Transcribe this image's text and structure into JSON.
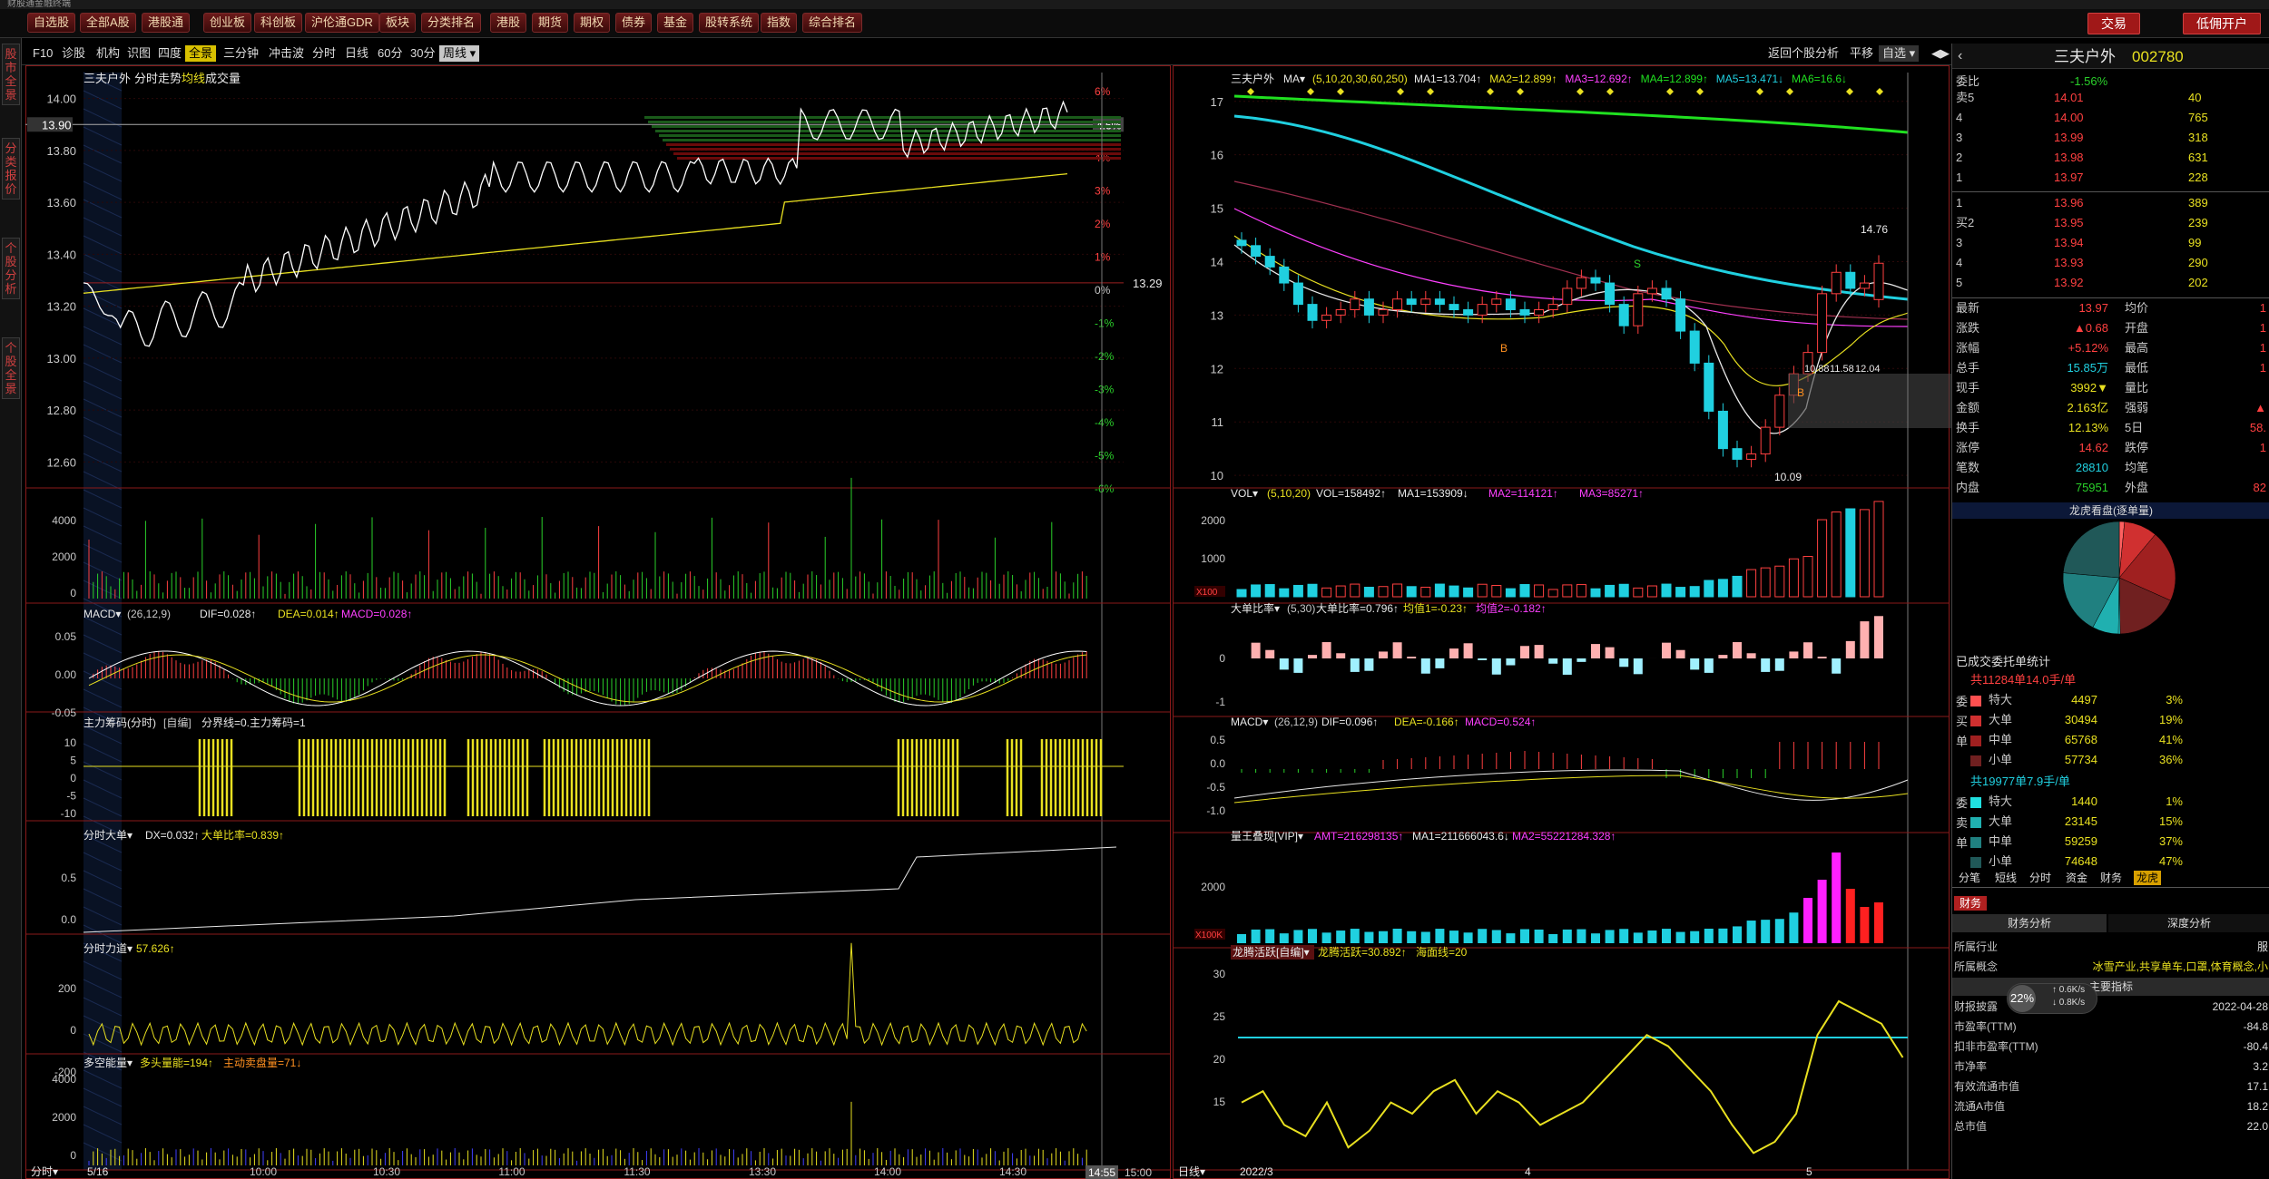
{
  "titlebar": {
    "left_text": "财股通金融终端"
  },
  "menubar": {
    "buttons": [
      "自选股",
      "全部A股",
      "港股通",
      "创业板",
      "科创板",
      "沪伦通GDR",
      "板块",
      "分类排名",
      "港股",
      "期货",
      "期权",
      "债券",
      "基金",
      "股转系统",
      "指数",
      "综合排名"
    ],
    "right_buttons": [
      "交易",
      "低佣开户"
    ]
  },
  "sidebar": {
    "tabs": [
      "股市全景",
      "分类报价",
      "个股分析",
      "个股全景"
    ]
  },
  "toolbar": {
    "items": [
      "F10",
      "诊股",
      "机构",
      "识图",
      "四度",
      "全景",
      "三分钟",
      "冲击波"
    ],
    "period": [
      "分时",
      "日线",
      "60分",
      "30分",
      "周线"
    ],
    "right": [
      "返回个股分析",
      "平移",
      "自选"
    ]
  },
  "intraday": {
    "title": "三夫户外",
    "sub": "分时走势",
    "legend": [
      "均线",
      "成交量"
    ],
    "price_labels": [
      "14.00",
      "13.80",
      "13.60",
      "13.40",
      "13.20",
      "13.00",
      "12.80",
      "12.60"
    ],
    "current_price_tag": "13.90",
    "pct_labels": [
      "6%",
      "5%",
      "4%",
      "3%",
      "2%",
      "1%",
      "0%",
      "-1%",
      "-2%",
      "-3%",
      "-4%",
      "-5%",
      "-6%"
    ],
    "current_pct_tag": "4.6%",
    "prev_close": "13.29",
    "vol_ticks": [
      "4000",
      "2000",
      "0"
    ],
    "date_label": "5/16",
    "time_axis": [
      "10:00",
      "10:30",
      "11:00",
      "11:30",
      "13:30",
      "14:00",
      "14:30",
      "15:00"
    ],
    "time_tag": "14:55",
    "axis_caption": "分时",
    "macd": {
      "name": "MACD",
      "params": "(26,12,9)",
      "dif": "DIF=0.028↑",
      "dea": "DEA=0.014↑",
      "macd": "MACD=0.028↑",
      "ticks": [
        "0.05",
        "0.00",
        "-0.05"
      ]
    },
    "zlcm": {
      "name": "主力筹码(分时)",
      "tag": "[自编]",
      "text": "分界线=0.主力筹码=1",
      "ticks": [
        "10",
        "5",
        "0",
        "-5",
        "-10"
      ]
    },
    "fsdd": {
      "name": "分时大单",
      "dx": "DX=0.032↑",
      "ratio": "大单比率=0.839↑",
      "ticks": [
        "0.5",
        "0.0"
      ]
    },
    "fsld": {
      "name": "分时力道",
      "val": "57.626↑",
      "ticks": [
        "200",
        "0",
        "-200"
      ]
    },
    "dknl": {
      "name": "多空能量",
      "bull": "多头量能=194↑",
      "bear": "主动卖盘量=71↓",
      "ticks": [
        "4000",
        "2000",
        "0"
      ]
    }
  },
  "daily": {
    "title": "三夫户外",
    "ma_header": "MA",
    "ma_params": "(5,10,20,30,60,250)",
    "ma_values": [
      "MA1=13.704↑",
      "MA2=12.899↑",
      "MA3=12.692↑",
      "MA4=12.899↑",
      "MA5=13.471↓",
      "MA6=16.6↓"
    ],
    "ma_colors": [
      "#e8e8e8",
      "#e8e020",
      "#ff40ff",
      "#20e020",
      "#20d0e0",
      "#20e020"
    ],
    "price_ticks": [
      "17",
      "16",
      "15",
      "14",
      "13",
      "12",
      "11",
      "10"
    ],
    "marks": {
      "high": "14.76",
      "low": "10.09",
      "mid": "10.88",
      "mid2": "11.58",
      "mid3": "12.04"
    },
    "date_axis": [
      "2022/3",
      "4",
      "5"
    ],
    "axis_caption": "日线",
    "vol": {
      "name": "VOL",
      "params": "(5,10,20)",
      "val": "VOL=158492↑",
      "ma1": "MA1=153909↓",
      "ma2": "MA2=114121↑",
      "ma3": "MA3=85271↑",
      "ticks": [
        "2000",
        "1000"
      ],
      "unit_tag": "X100"
    },
    "ddbl": {
      "name": "大单比率",
      "params": "(5,30)",
      "val": "大单比率=0.796↑",
      "j1": "均值1=-0.23↑",
      "j2": "均值2=-0.182↑",
      "ticks": [
        "0",
        "-1"
      ]
    },
    "macd": {
      "name": "MACD",
      "params": "(26,12,9)",
      "dif": "DIF=0.096↑",
      "dea": "DEA=-0.166↑",
      "macd": "MACD=0.524↑",
      "ticks": [
        "0.5",
        "0.0",
        "-0.5",
        "-1.0"
      ]
    },
    "lw": {
      "name": "量王叠现[VIP]",
      "amt": "AMT=216298135↑",
      "ma1": "MA1=211666043.6↓",
      "ma2": "MA2=55221284.328↑",
      "ticks": [
        "2000"
      ],
      "unit_tag": "X100K"
    },
    "lthy": {
      "name": "龙腾活跃[自编]",
      "val": "龙腾活跃=30.892↑",
      "sea": "海面线=20",
      "ticks": [
        "30",
        "25",
        "20",
        "15"
      ]
    }
  },
  "quote": {
    "name": "三夫户外",
    "code": "002780",
    "weibi_label": "委比",
    "weibi_val": "-1.56%",
    "asks": [
      {
        "l": "卖5",
        "p": "14.01",
        "v": "40"
      },
      {
        "l": "4",
        "p": "14.00",
        "v": "765"
      },
      {
        "l": "3",
        "p": "13.99",
        "v": "318"
      },
      {
        "l": "2",
        "p": "13.98",
        "v": "631"
      },
      {
        "l": "1",
        "p": "13.97",
        "v": "228"
      }
    ],
    "bids": [
      {
        "l": "1",
        "p": "13.96",
        "v": "389"
      },
      {
        "l": "买2",
        "p": "13.95",
        "v": "239"
      },
      {
        "l": "3",
        "p": "13.94",
        "v": "99"
      },
      {
        "l": "4",
        "p": "13.93",
        "v": "290"
      },
      {
        "l": "5",
        "p": "13.92",
        "v": "202"
      }
    ],
    "stats_left": [
      {
        "k": "最新",
        "v": "13.97"
      },
      {
        "k": "涨跌",
        "v": "▲0.68"
      },
      {
        "k": "涨幅",
        "v": "+5.12%"
      },
      {
        "k": "总手",
        "v": "15.85万"
      },
      {
        "k": "现手",
        "v": "3992▼"
      },
      {
        "k": "金额",
        "v": "2.163亿"
      },
      {
        "k": "换手",
        "v": "12.13%"
      },
      {
        "k": "涨停",
        "v": "14.62"
      },
      {
        "k": "笔数",
        "v": "28810"
      },
      {
        "k": "内盘",
        "v": "75951"
      }
    ],
    "stats_right": [
      {
        "k": "均价",
        "v": "1"
      },
      {
        "k": "开盘",
        "v": "1"
      },
      {
        "k": "最高",
        "v": "1"
      },
      {
        "k": "最低",
        "v": "1"
      },
      {
        "k": "量比",
        "v": ""
      },
      {
        "k": "强弱",
        "v": "▲"
      },
      {
        "k": "5日",
        "v": "58."
      },
      {
        "k": "跌停",
        "v": "1"
      },
      {
        "k": "均笔",
        "v": ""
      },
      {
        "k": "外盘",
        "v": "82"
      }
    ]
  },
  "longhu": {
    "title": "龙虎看盘(逐单量)",
    "subtitle": "已成交委托单统计",
    "buy_head": "共11284单14.0手/单",
    "buy_side": [
      "委",
      "买",
      "单"
    ],
    "buy": [
      {
        "k": "特大",
        "v": "4497",
        "p": "3%",
        "c": "#ff5050"
      },
      {
        "k": "大单",
        "v": "30494",
        "p": "19%",
        "c": "#d03030"
      },
      {
        "k": "中单",
        "v": "65768",
        "p": "41%",
        "c": "#a02020"
      },
      {
        "k": "小单",
        "v": "57734",
        "p": "36%",
        "c": "#702020"
      }
    ],
    "sell_head": "共19977单7.9手/单",
    "sell_side": [
      "委",
      "卖",
      "单"
    ],
    "sell": [
      {
        "k": "特大",
        "v": "1440",
        "p": "1%",
        "c": "#20e0e0"
      },
      {
        "k": "大单",
        "v": "23145",
        "p": "15%",
        "c": "#20b0b0"
      },
      {
        "k": "中单",
        "v": "59259",
        "p": "37%",
        "c": "#208080"
      },
      {
        "k": "小单",
        "v": "74648",
        "p": "47%",
        "c": "#205858"
      }
    ],
    "pie": [
      {
        "v": 3,
        "c": "#ff6060"
      },
      {
        "v": 19,
        "c": "#d03030"
      },
      {
        "v": 41,
        "c": "#a02020"
      },
      {
        "v": 36,
        "c": "#702020"
      },
      {
        "v": 1,
        "c": "#30f0f0"
      },
      {
        "v": 15,
        "c": "#20b0b0"
      },
      {
        "v": 37,
        "c": "#208080"
      },
      {
        "v": 47,
        "c": "#205858"
      }
    ],
    "tabs": [
      "分笔",
      "短线",
      "分时",
      "资金",
      "财务",
      "龙虎"
    ]
  },
  "finance": {
    "tab": "财务",
    "subtabs": [
      "财务分析",
      "深度分析"
    ],
    "rows": [
      {
        "k": "所属行业",
        "v": "服"
      },
      {
        "k": "所属概念",
        "v": "冰雪产业,共享单车,口罩,体育概念,小"
      },
      {
        "k": "财报披露",
        "v": "2022-04-28"
      },
      {
        "k": "市盈率(TTM)",
        "v": "-84.8"
      },
      {
        "k": "扣非市盈率(TTM)",
        "v": "-80.4"
      },
      {
        "k": "市净率",
        "v": "3.2"
      },
      {
        "k": "有效流通市值",
        "v": "17.1"
      },
      {
        "k": "流通A市值",
        "v": "18.2"
      },
      {
        "k": "总市值",
        "v": "22.0"
      }
    ],
    "main_indicator": "主要指标",
    "net_widget": {
      "pct": "22%",
      "up": "0.6K/s",
      "down": "0.8K/s"
    }
  }
}
